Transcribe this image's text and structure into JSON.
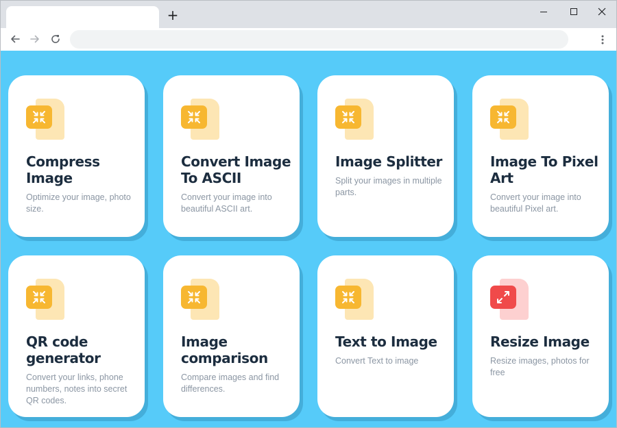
{
  "browser": {
    "new_tab_label": "+",
    "tab_title": "",
    "address": ""
  },
  "colors": {
    "page_background": "#56cbf9",
    "card_background": "#ffffff",
    "title_text": "#1c2d3f",
    "desc_text": "#8b96a3",
    "compress_icon_square": "#f7b731",
    "compress_icon_doc": "#fde6b4",
    "resize_icon_square": "#f04a4a",
    "resize_icon_doc": "#fdd0d0"
  },
  "tools": [
    {
      "title": "Compress Image",
      "desc": "Optimize your image, photo size.",
      "icon": "compress-icon",
      "theme": "yellow"
    },
    {
      "title": "Convert Image To ASCII",
      "desc": "Convert your image into beautiful ASCII art.",
      "icon": "compress-icon",
      "theme": "yellow"
    },
    {
      "title": "Image Splitter",
      "desc": "Split your images in multiple parts.",
      "icon": "compress-icon",
      "theme": "yellow"
    },
    {
      "title": "Image To Pixel Art",
      "desc": "Convert your image into beautiful Pixel art.",
      "icon": "compress-icon",
      "theme": "yellow"
    },
    {
      "title": "QR code generator",
      "desc": "Convert your links, phone numbers, notes into secret QR codes.",
      "icon": "compress-icon",
      "theme": "yellow"
    },
    {
      "title": "Image comparison",
      "desc": "Compare images and find differences.",
      "icon": "compress-icon",
      "theme": "yellow"
    },
    {
      "title": "Text to Image",
      "desc": "Convert Text to image",
      "icon": "compress-icon",
      "theme": "yellow"
    },
    {
      "title": "Resize Image",
      "desc": "Resize images, photos for free",
      "icon": "expand-icon",
      "theme": "red"
    }
  ]
}
